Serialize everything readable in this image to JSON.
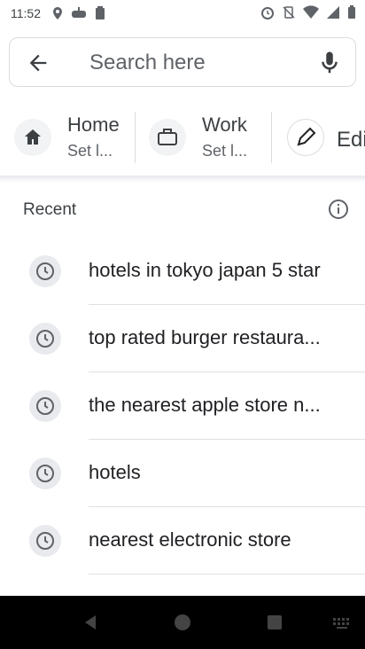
{
  "status_bar": {
    "time": "11:52"
  },
  "search": {
    "placeholder": "Search here"
  },
  "shortcuts": [
    {
      "title": "Home",
      "subtitle": "Set l...",
      "icon": "home-icon"
    },
    {
      "title": "Work",
      "subtitle": "Set l...",
      "icon": "briefcase-icon"
    },
    {
      "title": "Edi",
      "icon": "pencil-icon"
    }
  ],
  "recent": {
    "label": "Recent",
    "items": [
      "hotels in tokyo japan 5 star",
      "top rated burger restaura...",
      "the nearest apple store n...",
      "hotels",
      "nearest electronic store"
    ]
  },
  "colors": {
    "icon_gray": "#5f6368",
    "text_dark": "#202124",
    "nav_bg": "#000000"
  }
}
